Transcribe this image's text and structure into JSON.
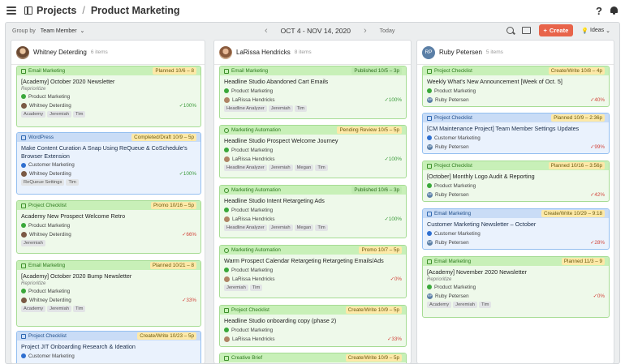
{
  "header": {
    "crumb_projects": "Projects",
    "crumb_separator": "/",
    "crumb_current": "Product Marketing",
    "help": "?"
  },
  "toolbar": {
    "group_label": "Group by",
    "group_value": "Team Member",
    "date_range": "OCT 4 - NOV 14, 2020",
    "today": "Today",
    "create_label": "Create",
    "ideas_label": "Ideas"
  },
  "columns": [
    {
      "name": "Whitney Deterding",
      "count": "6 items",
      "cards": [
        {
          "type": "Email Marketing",
          "status": "Planned 10/6 – 8",
          "color": "green",
          "title": "[Academy] October 2020 Newsletter",
          "note": "Reprioritize",
          "project": "Product Marketing",
          "project_color": "green",
          "owner": "Whitney Deterding",
          "progress": "100%",
          "tags": [
            "Academy",
            "Jeremiah",
            "Tim"
          ]
        },
        {
          "type": "WordPress",
          "status": "Completed/Draft 10/9 – 5p",
          "color": "blue",
          "title": "Make Content Curation A Snap Using ReQueue & CoSchedule's Browser Extension",
          "project": "Customer Marketing",
          "project_color": "blue",
          "owner": "Whitney Deterding",
          "progress": "100%",
          "tags": [
            "ReQueue Settings",
            "Tim"
          ]
        },
        {
          "type": "Project Checklist",
          "status": "Promo 10/16 – 5p",
          "color": "green",
          "title": "Academy New Prospect Welcome Retro",
          "project": "Product Marketing",
          "project_color": "green",
          "owner": "Whitney Deterding",
          "progress": "66%",
          "tags": [
            "Jeremiah"
          ]
        },
        {
          "type": "Email Marketing",
          "status": "Planned 10/21 – 8",
          "color": "green",
          "title": "[Academy] October 2020 Bump Newsletter",
          "note": "Reprioritize",
          "project": "Product Marketing",
          "project_color": "green",
          "owner": "Whitney Deterding",
          "progress": "33%",
          "tags": [
            "Academy",
            "Jeremiah",
            "Tim"
          ]
        },
        {
          "type": "Project Checklist",
          "status": "Create/Write 10/23 – 5p",
          "color": "blue",
          "title": "Project JIT Onboarding Research & Ideation",
          "project": "Customer Marketing",
          "project_color": "blue"
        }
      ]
    },
    {
      "name": "LaRissa Hendricks",
      "count": "8 items",
      "cards": [
        {
          "type": "Email Marketing",
          "status": "Published 10/5 – 3p",
          "color": "green",
          "title": "Headline Studio Abandoned Cart Emails",
          "project": "Product Marketing",
          "project_color": "green",
          "owner": "LaRissa Hendricks",
          "progress": "100%",
          "tags": [
            "Headline Analyzer",
            "Jeremiah",
            "Tim"
          ]
        },
        {
          "type": "Marketing Automation",
          "status": "Pending Review 10/5 – 5p",
          "color": "green",
          "title": "Headline Studio Prospect Welcome Journey",
          "project": "Product Marketing",
          "project_color": "green",
          "owner": "LaRissa Hendricks",
          "progress": "100%",
          "tags": [
            "Headline Analyzer",
            "Jeremiah",
            "Megan",
            "Tim"
          ]
        },
        {
          "type": "Marketing Automation",
          "status": "Published 10/6 – 3p",
          "color": "green",
          "title": "Headline Studio Intent Retargeting Ads",
          "project": "Product Marketing",
          "project_color": "green",
          "owner": "LaRissa Hendricks",
          "progress": "100%",
          "tags": [
            "Headline Analyzer",
            "Jeremiah",
            "Megan",
            "Tim"
          ]
        },
        {
          "type": "Marketing Automation",
          "status": "Promo 10/7 – 5p",
          "color": "green",
          "title": "Warm Prospect Calendar Retargeting Retargeting Emails/Ads",
          "project": "Product Marketing",
          "project_color": "green",
          "owner": "LaRissa Hendricks",
          "progress": "0%",
          "tags": [
            "Jeremiah",
            "Tim"
          ]
        },
        {
          "type": "Project Checklist",
          "status": "Create/Write 10/9 – 5p",
          "color": "green",
          "title": "Headline Studio onboarding copy (phase 2)",
          "project": "Product Marketing",
          "project_color": "green",
          "owner": "LaRissa Hendricks",
          "progress": "33%"
        },
        {
          "type": "Creative Brief",
          "status": "Create/Write 10/9 – 5p",
          "color": "green"
        }
      ]
    },
    {
      "name": "Ruby Petersen",
      "count": "5 items",
      "initials": "RP",
      "cards": [
        {
          "type": "Project Checklist",
          "status": "Create/Write 10/8 – 4p",
          "color": "green",
          "title": "Weekly What's New Announcement [Week of Oct. 5]",
          "project": "Product Marketing",
          "project_color": "green",
          "owner": "Ruby Petersen",
          "progress": "40%"
        },
        {
          "type": "Project Checklist",
          "status": "Planned 10/9 – 2:36p",
          "color": "blue",
          "title": "[CM Maintenance Project] Team Member Settings Updates",
          "project": "Customer Marketing",
          "project_color": "blue",
          "owner": "Ruby Petersen",
          "progress": "99%"
        },
        {
          "type": "Project Checklist",
          "status": "Planned 10/16 – 3:56p",
          "color": "green",
          "title": "[October] Monthly Logo Audit & Reporting",
          "project": "Product Marketing",
          "project_color": "green",
          "owner": "Ruby Petersen",
          "progress": "42%"
        },
        {
          "type": "Email Marketing",
          "status": "Create/Write 10/29 – 9:18",
          "color": "blue",
          "title": "Customer Marketing Newsletter – October",
          "project": "Customer Marketing",
          "project_color": "blue",
          "owner": "Ruby Petersen",
          "progress": "28%"
        },
        {
          "type": "Email Marketing",
          "status": "Planned 11/3 – 9",
          "color": "green",
          "title": "[Academy] November 2020 Newsletter",
          "note": "Reprioritize",
          "project": "Product Marketing",
          "project_color": "green",
          "owner": "Ruby Petersen",
          "progress": "0%",
          "tags": [
            "Academy",
            "Jeremiah",
            "Tim"
          ]
        }
      ]
    }
  ]
}
